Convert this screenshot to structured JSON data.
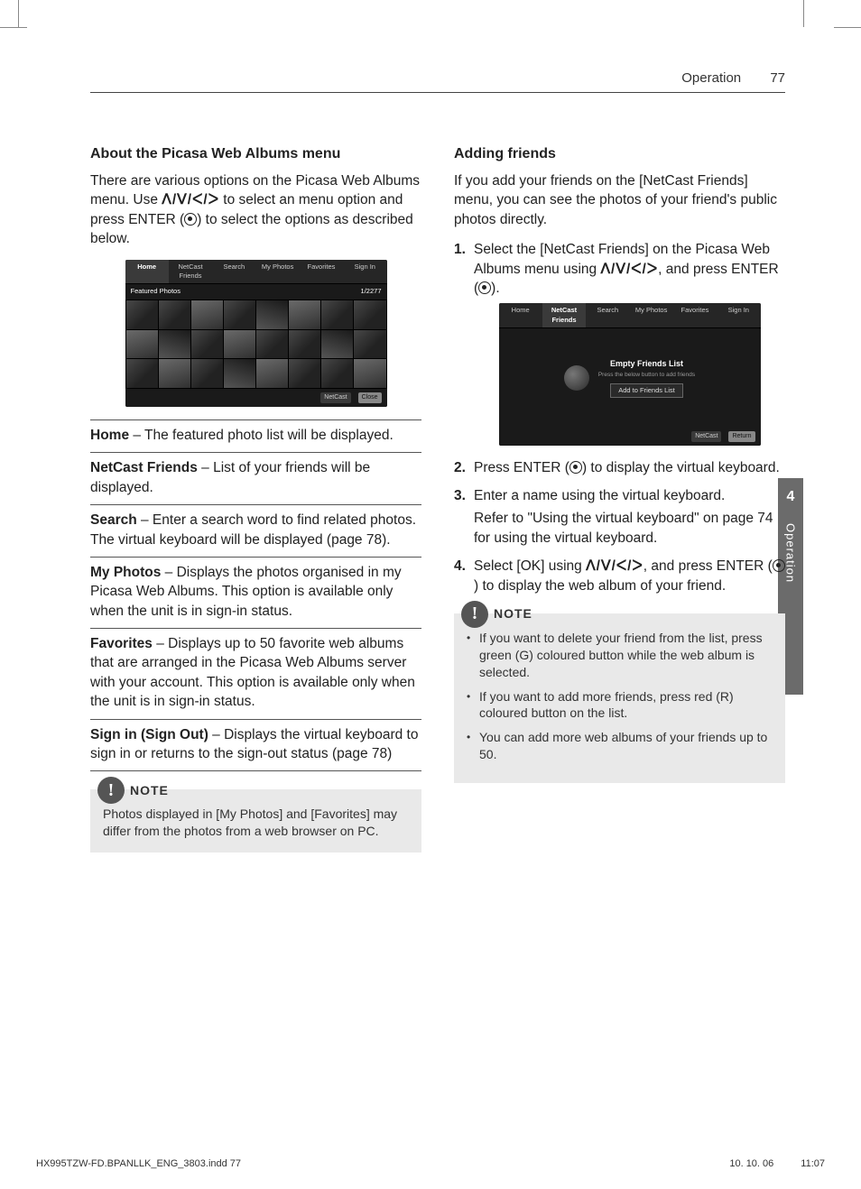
{
  "header": {
    "section": "Operation",
    "page_number": "77"
  },
  "sidetab": {
    "chapter_number": "4",
    "chapter_label": "Operation"
  },
  "left": {
    "heading": "About the Picasa Web Albums menu",
    "intro_a": "There are various options on the Picasa Web Albums menu. Use ",
    "intro_nav": "ᐱ/ᐯ/ᐸ/ᐳ",
    "intro_b": " to select an menu option and press ENTER (",
    "intro_c": ") to select the options as described below.",
    "shot1": {
      "tabs": [
        "Home",
        "NetCast Friends",
        "Search",
        "My Photos",
        "Favorites",
        "Sign In"
      ],
      "selected_tab": 0,
      "subtitle": "Featured Photos",
      "counter": "1/2277",
      "footer_a": "NetCast",
      "footer_b": "Close"
    },
    "defs": [
      {
        "term": "Home",
        "body": " – The featured photo list will be displayed."
      },
      {
        "term": "NetCast Friends",
        "body": " – List of your friends will be displayed."
      },
      {
        "term": "Search",
        "body": " – Enter a search word to find related photos. The virtual keyboard will be displayed (page 78)."
      },
      {
        "term": "My Photos",
        "body": " – Displays the photos organised in my Picasa Web Albums. This option is available only when the unit is in sign-in status."
      },
      {
        "term": "Favorites",
        "body": " – Displays up to 50 favorite web albums that are arranged in the Picasa Web Albums server with your account. This option is available only when the unit is in sign-in status."
      },
      {
        "term": "Sign in (Sign Out)",
        "body": " – Displays the virtual keyboard to sign in or returns to the sign-out status (page 78)"
      }
    ],
    "note_label": "NOTE",
    "note_text": "Photos displayed in [My Photos] and [Favorites] may differ from the photos from a web browser on PC."
  },
  "right": {
    "heading": "Adding friends",
    "intro": "If you add your friends on the [NetCast Friends] menu, you can see the photos of your friend's public photos directly.",
    "step1_a": "Select the [NetCast Friends] on the Picasa Web Albums menu using ",
    "step1_nav": "ᐱ/ᐯ/ᐸ/ᐳ",
    "step1_b": ", and press ENTER (",
    "step1_c": ").",
    "shot2": {
      "tabs": [
        "Home",
        "NetCast Friends",
        "Search",
        "My Photos",
        "Favorites",
        "Sign In"
      ],
      "selected_tab": 1,
      "empty_title": "Empty Friends List",
      "empty_sub": "Press the below button to add friends",
      "empty_btn": "Add to Friends List",
      "footer_a": "NetCast",
      "footer_b": "Return"
    },
    "step2_a": "Press ENTER (",
    "step2_b": ") to display the virtual keyboard.",
    "step3_a": "Enter a name using the virtual keyboard.",
    "step3_b": "Refer to \"Using the virtual keyboard\" on page 74 for using the virtual keyboard.",
    "step4_a": "Select [OK] using ",
    "step4_nav": "ᐱ/ᐯ/ᐸ/ᐳ",
    "step4_b": ", and press ENTER (",
    "step4_c": ") to display the web album of your friend.",
    "note_label": "NOTE",
    "notes": [
      "If you want to delete your friend from the list, press green (G) coloured button while the web album is selected.",
      "If you want to add more friends, press red (R) coloured button on the list.",
      "You can add more web albums of your friends up to 50."
    ]
  },
  "printfoot": {
    "file": "HX995TZW-FD.BPANLLK_ENG_3803.indd   77",
    "date": "10. 10. 06",
    "time": "11:07"
  }
}
